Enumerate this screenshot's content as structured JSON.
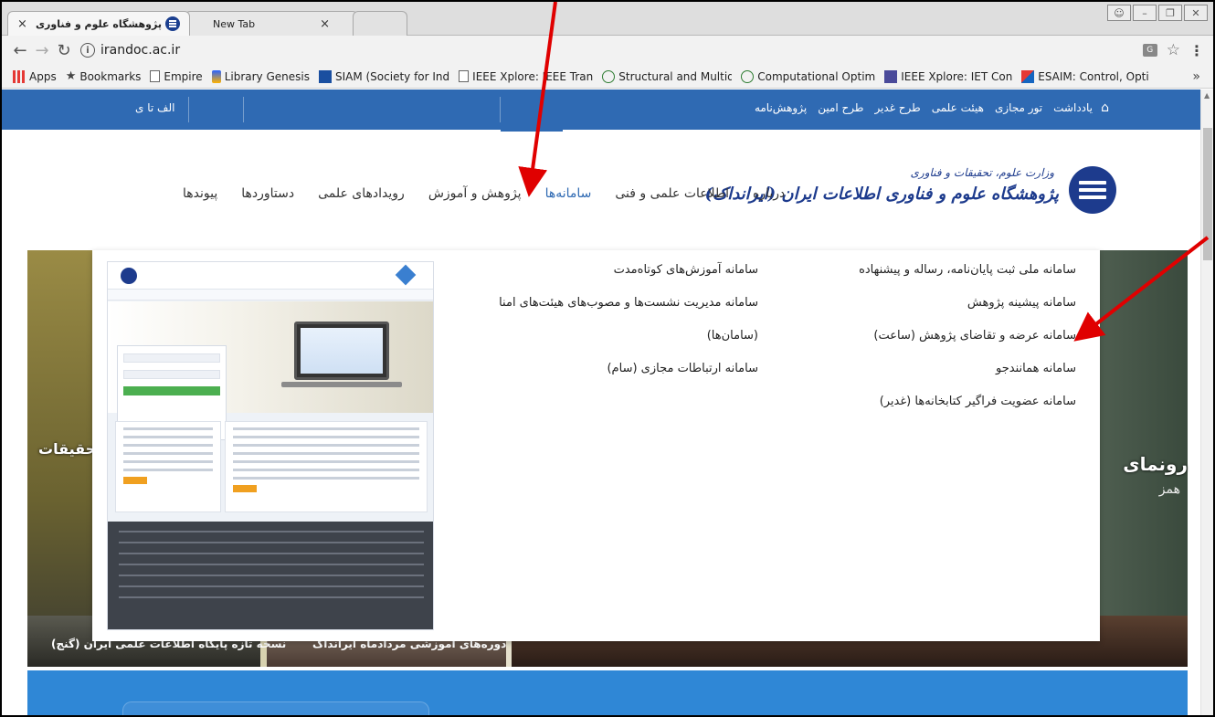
{
  "browser": {
    "tabs": [
      {
        "title": "پژوهشگاه علوم و فناوری اطلاعا"
      },
      {
        "title": "New Tab"
      }
    ],
    "url": "irandoc.ac.ir",
    "bookmarks": [
      "Apps",
      "Bookmarks",
      "Empire",
      "Library Genesis",
      "SIAM (Society for Ind",
      "IEEE Xplore: IEEE Tran",
      "Structural and Multid",
      "Computational Optim",
      "IEEE Xplore: IET Cont",
      "ESAIM: Control, Opti"
    ],
    "more": "»"
  },
  "topbar": {
    "links": [
      "یادداشت",
      "تور مجازی",
      "هیئت علمی",
      "طرح غدیر",
      "طرح امین",
      "پژوهش‌نامه"
    ],
    "alefta": "الف تا ی"
  },
  "logo": {
    "line1": "وزارت علوم، تحقیقات و فناوری",
    "line2": "پژوهشگاه علوم و فناوری اطلاعات ایران (ایرانداک)"
  },
  "mainnav": {
    "items": [
      "درباره",
      "اطلاعات علمی و فنی",
      "سامانه‌ها",
      "پژوهش و آموزش",
      "رویدادهای علمی",
      "دستاوردها",
      "پیوندها"
    ],
    "active_index": 2
  },
  "dropdown": {
    "column1": [
      "سامانه ملی ثبت پایان‌نامه، رساله و پیشنهاده",
      "سامانه پیشینه پژوهش",
      "سامانه عرضه و تقاضای پژوهش (ساعت)",
      "سامانه همانندجو",
      "سامانه عضویت فراگیر کتابخانه‌ها (غدیر)"
    ],
    "column2": [
      "سامانه آموزش‌های کوتاه‌مدت",
      "سامانه مدیریت نشست‌ها و مصوب‌های هیئت‌های امنا",
      "(سامان‌ها)",
      "سامانه ارتباطات مجازی (سام)"
    ]
  },
  "hero": {
    "side_text": "حقیقات",
    "right_text": "رونمای",
    "right_sub": "همز",
    "card1": "نسخه تازه پایگاه اطلاعات علمی ایران (گنج)",
    "card2": "دوره‌های آموزشی مرداد‌ماه ایرانداک"
  },
  "colors": {
    "topbar": "#2f6ab3",
    "active_menu": "#2f6ab3",
    "annotation_arrow": "#e00000",
    "blue_section": "#2f87d6"
  }
}
